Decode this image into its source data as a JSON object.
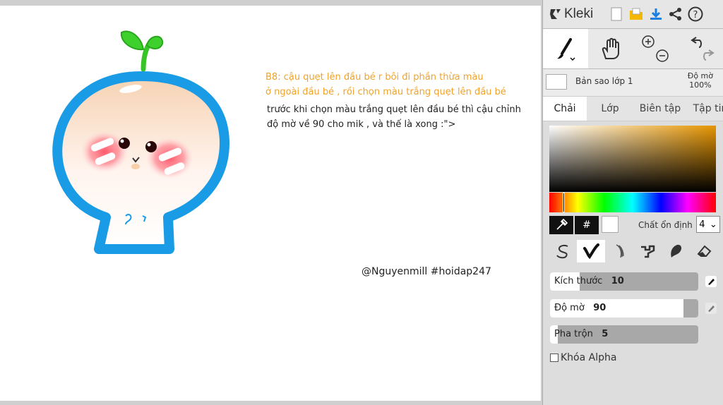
{
  "canvas": {
    "notes": {
      "step_line1": "B8: cậu quẹt lên đầu bé r bôi đi phần thừa màu",
      "step_line2": "ở ngoài đầu bé , rồi chọn màu trắng quẹt lên đầu bé",
      "body_line1": "trước khi chọn màu trắng quẹt lên đầu bé thì cậu chỉnh",
      "body_line2": "độ mờ về 90 cho mik , và thế là xong :\">",
      "signature": "@Nguyenmill #hoidap247"
    }
  },
  "app": {
    "name": "Kleki",
    "toolbar_icons": [
      "new-document-icon",
      "save-folder-icon",
      "download-icon",
      "share-icon",
      "help-icon"
    ],
    "tools": [
      "brush-tool-icon",
      "hand-tool-icon",
      "zoom-icon",
      "undo-redo-icon"
    ]
  },
  "layer": {
    "name": "Bản sao lớp 1",
    "opacity_label": "Độ mờ",
    "opacity_value": "100%"
  },
  "tabs": [
    "Chải",
    "Lớp",
    "Biên tập",
    "Tập tin"
  ],
  "color_picker": {
    "hash": "#",
    "stabilizer_label": "Chất ổn định",
    "stabilizer_value": "4",
    "current_color": "#ffffff",
    "hue_color": "#e69500"
  },
  "brushes": [
    "pen-brush-icon",
    "blend-brush-icon",
    "sketchy-brush-icon",
    "pixel-brush-icon",
    "chemy-brush-icon",
    "eraser-icon"
  ],
  "sliders": {
    "size_label": "Kích thước",
    "size_value": "10",
    "size_fraction": 0.2,
    "opacity_label": "Độ mờ",
    "opacity_value": "90",
    "opacity_fraction": 0.9,
    "blend_label": "Pha trộn",
    "blend_value": "5",
    "blend_fraction": 0.05
  },
  "alpha_lock_label": "Khóa Alpha"
}
